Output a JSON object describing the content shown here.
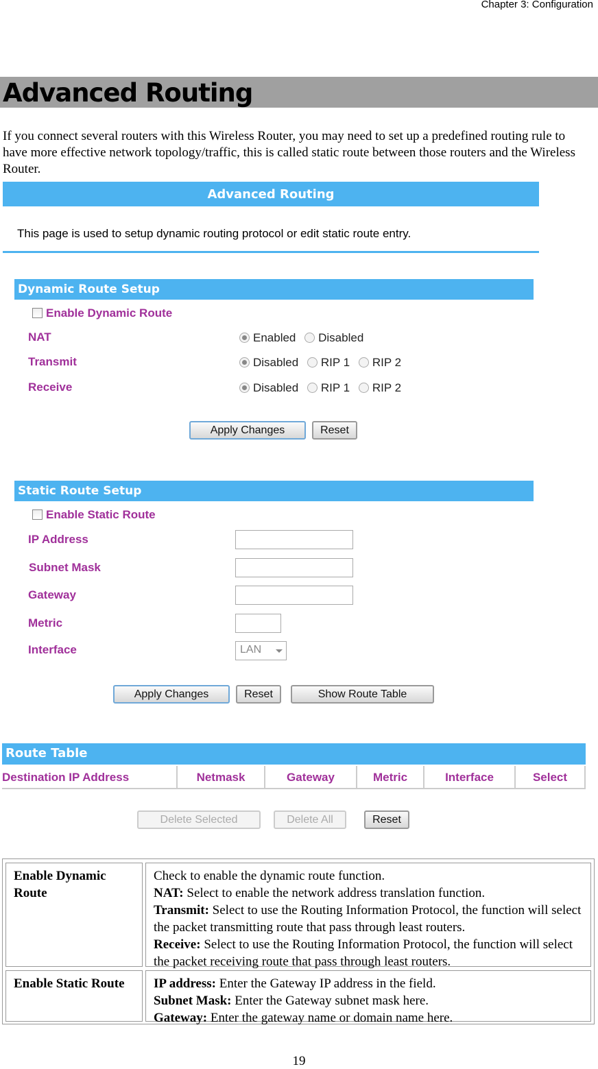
{
  "header": {
    "chapter": "Chapter 3: Configuration"
  },
  "section_title": "Advanced Routing",
  "intro": "If you connect several routers with this Wireless Router, you may need to set up a predefined routing rule to have more effective network topology/traffic, this is called static route between those routers and the Wireless Router.",
  "screenshot": {
    "title": "Advanced Routing",
    "description": "This page is used to setup dynamic routing protocol or edit static route entry.",
    "accent": "#4db3f0",
    "label_color": "#a0309a",
    "dynamic": {
      "heading": "Dynamic Route Setup",
      "enable_label": "Enable Dynamic Route",
      "enabled": false,
      "nat": {
        "label": "NAT",
        "options": [
          "Enabled",
          "Disabled"
        ],
        "selected": "Enabled"
      },
      "transmit": {
        "label": "Transmit",
        "options": [
          "Disabled",
          "RIP 1",
          "RIP 2"
        ],
        "selected": "Disabled"
      },
      "receive": {
        "label": "Receive",
        "options": [
          "Disabled",
          "RIP 1",
          "RIP 2"
        ],
        "selected": "Disabled"
      },
      "apply": "Apply Changes",
      "reset": "Reset"
    },
    "static": {
      "heading": "Static Route Setup",
      "enable_label": "Enable Static Route",
      "enabled": false,
      "ip_label": "IP Address",
      "ip_value": "",
      "mask_label": "Subnet Mask",
      "mask_value": "",
      "gw_label": "Gateway",
      "gw_value": "",
      "metric_label": "Metric",
      "metric_value": "",
      "iface_label": "Interface",
      "iface_value": "LAN",
      "apply": "Apply Changes",
      "reset": "Reset",
      "show": "Show Route Table"
    },
    "route_table": {
      "heading": "Route Table",
      "columns": [
        "Destination IP Address",
        "Netmask",
        "Gateway",
        "Metric",
        "Interface",
        "Select"
      ],
      "delete_selected": "Delete Selected",
      "delete_all": "Delete All",
      "reset": "Reset"
    }
  },
  "desc_table": [
    {
      "term": "Enable Dynamic Route",
      "lines": [
        {
          "b": "",
          "t": "Check to enable the dynamic route function."
        },
        {
          "b": "NAT:",
          "t": " Select to enable the network address translation function."
        },
        {
          "b": "Transmit:",
          "t": " Select to use the Routing Information Protocol, the function will select the packet transmitting route that pass through least routers."
        },
        {
          "b": "Receive:",
          "t": " Select to use the Routing Information Protocol, the function will select the packet receiving route that pass through least routers."
        }
      ]
    },
    {
      "term": "Enable Static Route",
      "lines": [
        {
          "b": "IP address:",
          "t": " Enter the Gateway IP address in the field."
        },
        {
          "b": "Subnet Mask:",
          "t": " Enter the Gateway subnet mask here."
        },
        {
          "b": "Gateway:",
          "t": " Enter the gateway name or domain name here."
        }
      ]
    }
  ],
  "page_number": "19"
}
